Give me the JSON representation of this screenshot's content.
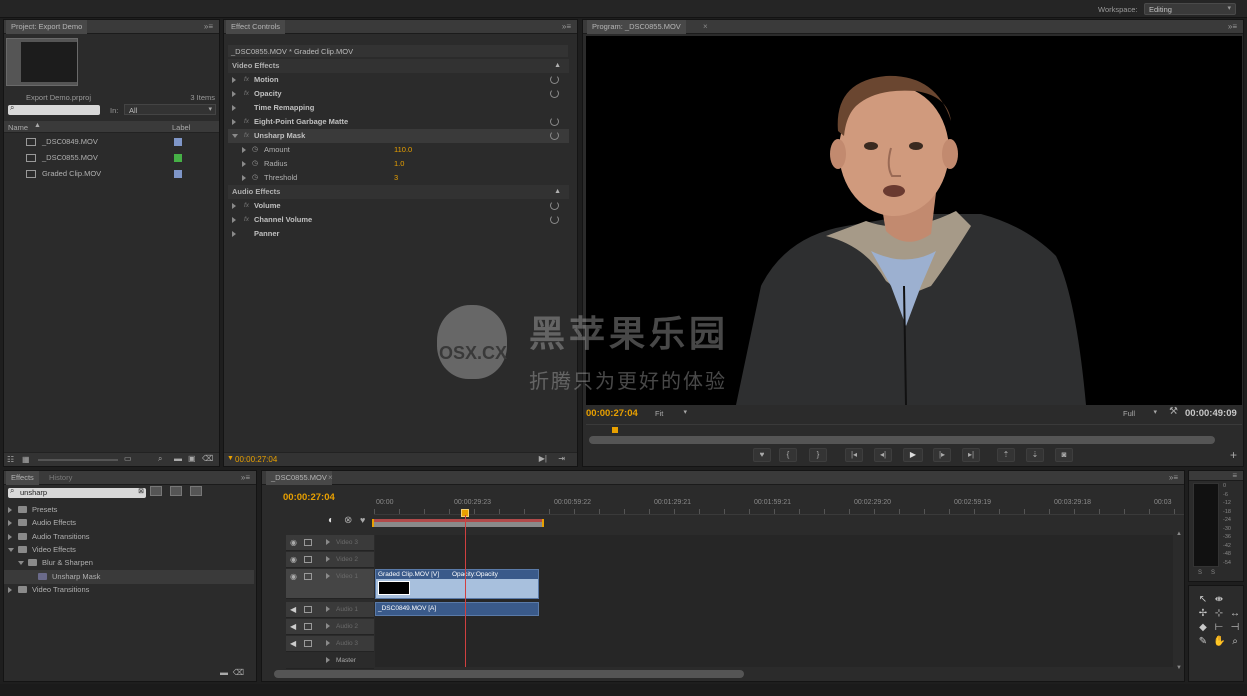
{
  "app": {
    "workspace_label": "Workspace:",
    "workspace_value": "Editing"
  },
  "project": {
    "tab": "Project: Export Demo",
    "project_file": "Export Demo.prproj",
    "item_count": "3 Items",
    "search_placeholder": "",
    "in_label": "In:",
    "in_value": "All",
    "col_name": "Name",
    "col_label": "Label",
    "items": [
      {
        "name": "_DSC0849.MOV",
        "color": "#7f96c8"
      },
      {
        "name": "_DSC0855.MOV",
        "color": "#46b046"
      },
      {
        "name": "Graded Clip.MOV",
        "color": "#7f96c8"
      }
    ]
  },
  "effect_controls": {
    "tab": "Effect Controls",
    "clip_path": "_DSC0855.MOV * Graded Clip.MOV",
    "video_effects_label": "Video Effects",
    "audio_effects_label": "Audio Effects",
    "video_effects": [
      {
        "name": "Motion",
        "fx": "fx",
        "reset": true
      },
      {
        "name": "Opacity",
        "fx": "fx",
        "reset": true
      },
      {
        "name": "Time Remapping",
        "fx": "",
        "reset": false
      },
      {
        "name": "Eight-Point Garbage Matte",
        "fx": "fx",
        "reset": true
      },
      {
        "name": "Unsharp Mask",
        "fx": "fx",
        "reset": true
      }
    ],
    "params": [
      {
        "name": "Amount",
        "value": "110.0"
      },
      {
        "name": "Radius",
        "value": "1.0"
      },
      {
        "name": "Threshold",
        "value": "3"
      }
    ],
    "audio_effects": [
      {
        "name": "Volume",
        "fx": "fx",
        "reset": true
      },
      {
        "name": "Channel Volume",
        "fx": "fx",
        "reset": true
      },
      {
        "name": "Panner",
        "fx": "",
        "reset": false
      }
    ],
    "timecode": "00:00:27:04"
  },
  "program": {
    "tab": "Program: _DSC0855.MOV",
    "timecode": "00:00:27:04",
    "fit": "Fit",
    "quality": "Full",
    "duration": "00:00:49:09"
  },
  "effects_panel": {
    "tab": "Effects",
    "tab2": "History",
    "search_value": "unsharp",
    "tree": [
      {
        "label": "Presets",
        "level": 0,
        "open": false,
        "folder": true
      },
      {
        "label": "Audio Effects",
        "level": 0,
        "open": false,
        "folder": true
      },
      {
        "label": "Audio Transitions",
        "level": 0,
        "open": false,
        "folder": true
      },
      {
        "label": "Video Effects",
        "level": 0,
        "open": true,
        "folder": true
      },
      {
        "label": "Blur & Sharpen",
        "level": 1,
        "open": true,
        "folder": true
      },
      {
        "label": "Unsharp Mask",
        "level": 2,
        "open": false,
        "folder": false
      },
      {
        "label": "Video Transitions",
        "level": 0,
        "open": false,
        "folder": true
      }
    ]
  },
  "timeline": {
    "tab": "_DSC0855.MOV",
    "timecode": "00:00:27:04",
    "ruler": [
      "00:00",
      "00:00:29:23",
      "00:00:59:22",
      "00:01:29:21",
      "00:01:59:21",
      "00:02:29:20",
      "00:02:59:19",
      "00:03:29:18",
      "00:03"
    ],
    "tracks": [
      {
        "name": "Video 3",
        "type": "video"
      },
      {
        "name": "Video 2",
        "type": "video"
      },
      {
        "name": "Video 1",
        "type": "video"
      },
      {
        "name": "Audio 1",
        "type": "audio"
      },
      {
        "name": "Audio 2",
        "type": "audio"
      },
      {
        "name": "Audio 3",
        "type": "audio"
      },
      {
        "name": "Master",
        "type": "master"
      }
    ],
    "video_clip": "Graded Clip.MOV [V]",
    "video_clip_fx": "Opacity:Opacity",
    "audio_clip": "_DSC0849.MOV [A]"
  },
  "meter": {
    "scale": [
      "0",
      "-6",
      "-12",
      "-18",
      "-24",
      "-30",
      "-36",
      "-42",
      "-48",
      "-54"
    ],
    "labels": [
      "S",
      "S"
    ]
  },
  "watermark": {
    "logo_text": "OSX.CX",
    "cn_text": "黑苹果乐园",
    "tagline": "折腾只为更好的体验"
  }
}
